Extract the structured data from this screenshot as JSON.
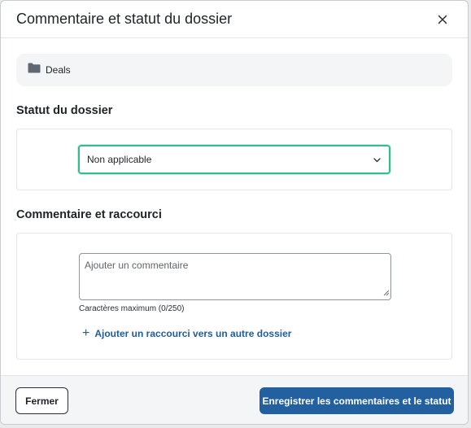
{
  "dialog": {
    "title": "Commentaire et statut du dossier",
    "close_icon": "close-icon"
  },
  "folder": {
    "icon": "folder-icon",
    "name": "Deals"
  },
  "status_section": {
    "title": "Statut du dossier",
    "selected_value": "Non applicable",
    "dropdown_icon": "chevron-down-icon",
    "accent_color": "#2fbf8f"
  },
  "comment_section": {
    "title": "Commentaire et raccourci",
    "placeholder": "Ajouter un commentaire",
    "value": "",
    "char_counter": "Caractères maximum (0/250)",
    "add_shortcut_label": "Ajouter un raccourci vers un autre dossier",
    "add_shortcut_icon": "plus-icon"
  },
  "footer": {
    "close_label": "Fermer",
    "save_label": "Enregistrer les commentaires et le statut",
    "save_color": "#2260a0"
  }
}
